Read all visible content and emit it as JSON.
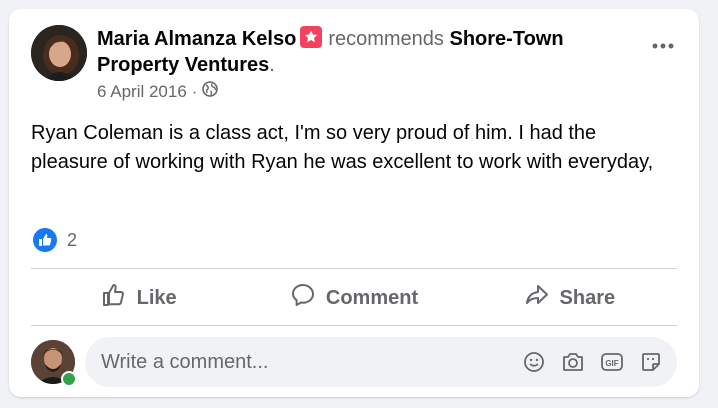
{
  "post": {
    "author": "Maria Almanza Kelso",
    "verb": "recommends",
    "page": "Shore-Town Property Ventures",
    "trailing": ".",
    "date": "6 April 2016",
    "separator": "·",
    "privacy_icon": "globe-icon",
    "text": "Ryan Coleman is a class act, I'm so very proud of him. I had the pleasure of working with Ryan  he was excellent to work with everyday,"
  },
  "reactions": {
    "icon": "like-icon",
    "count": "2"
  },
  "actions": {
    "like": "Like",
    "comment": "Comment",
    "share": "Share"
  },
  "composer": {
    "placeholder": "Write a comment...",
    "tools": [
      "emoji-icon",
      "camera-icon",
      "gif-icon",
      "sticker-icon"
    ]
  },
  "colors": {
    "brand_blue": "#1877f2",
    "recommend_badge": "#f3425f",
    "secondary_text": "#65676b",
    "online": "#31a24c"
  }
}
